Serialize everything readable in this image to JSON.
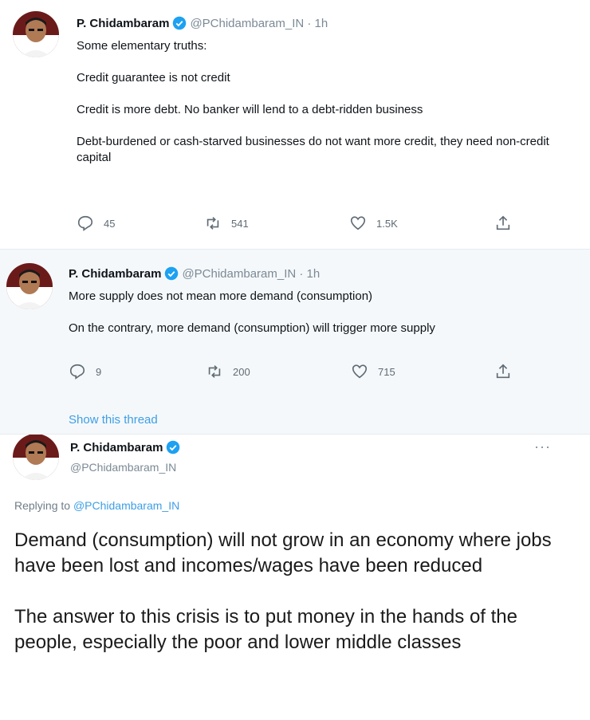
{
  "tweets": [
    {
      "name": "P. Chidambaram",
      "handle": "@PChidambaram_IN · 1h",
      "body": "Some elementary truths:\n\nCredit guarantee is not credit\n\nCredit is more debt. No banker will lend to a debt-ridden business\n\nDebt-burdened or cash-starved businesses do not want more credit, they need non-credit capital",
      "replies": "45",
      "retweets": "541",
      "likes": "1.5K"
    },
    {
      "name": "P. Chidambaram",
      "handle": "@PChidambaram_IN · 1h",
      "body": "More supply does not mean more demand (consumption)\n\nOn the contrary, more demand (consumption) will trigger more supply",
      "replies": "9",
      "retweets": "200",
      "likes": "715",
      "show_thread": "Show this thread"
    },
    {
      "name": "P. Chidambaram",
      "handle": "@PChidambaram_IN",
      "replying_prefix": "Replying to ",
      "replying_mention": "@PChidambaram_IN",
      "body": "Demand (consumption) will not grow in an economy where jobs have been lost and incomes/wages  have been reduced\n\nThe answer to this crisis is to put money in the hands of the people, especially the poor and lower middle classes",
      "more": "···"
    }
  ],
  "icons": {
    "reply": "reply-icon",
    "retweet": "retweet-icon",
    "like": "heart-icon",
    "share": "share-icon",
    "verified": "verified-badge-icon"
  },
  "colors": {
    "accent": "#1da1f2",
    "link": "#3d9fe6",
    "muted": "#7b8a96"
  }
}
